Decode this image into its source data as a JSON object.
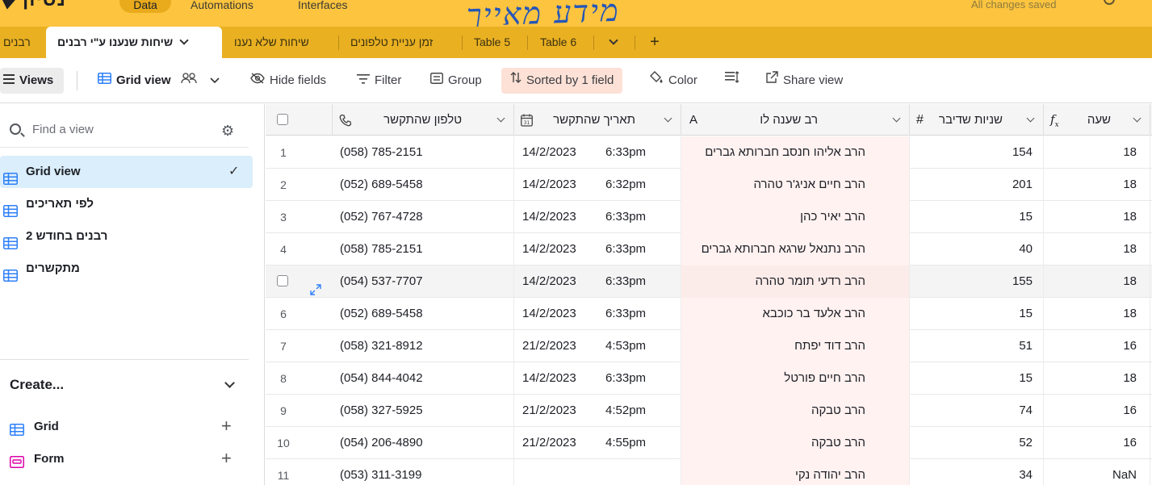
{
  "app": {
    "logo_text": "נסיון",
    "nav": {
      "data": "Data",
      "automations": "Automations",
      "interfaces": "Interfaces"
    },
    "save_status": "All changes saved",
    "handwritten_note": "מידע מאייך"
  },
  "tabs": {
    "items": [
      {
        "label": "רבנים"
      },
      {
        "label": "שיחות שנענו ע\"י רבנים",
        "active": true
      },
      {
        "label": "שיחות שלא נענו"
      },
      {
        "label": "זמן עניית טלפונים"
      },
      {
        "label": "Table 5"
      },
      {
        "label": "Table 6"
      }
    ],
    "more_icon": "chevron-down-icon",
    "add_label": "+"
  },
  "toolbar": {
    "views_label": "Views",
    "grid_view_label": "Grid view",
    "hide_fields_label": "Hide fields",
    "filter_label": "Filter",
    "group_label": "Group",
    "sorted_label": "Sorted by 1 field",
    "color_label": "Color",
    "share_view_label": "Share view",
    "sorted_bg": "#fde1d6"
  },
  "sidebar": {
    "find_placeholder": "Find a view",
    "views": [
      {
        "label": "Grid view",
        "selected": true
      },
      {
        "label": "לפי תאריכים"
      },
      {
        "label": "רבנים בחודש 2"
      },
      {
        "label": "מתקשרים"
      }
    ],
    "create_label": "Create...",
    "create_items": [
      {
        "label": "Grid"
      },
      {
        "label": "Form"
      }
    ]
  },
  "grid": {
    "columns": {
      "phone": "טלפון שהתקשר",
      "date": "תאריך שהתקשר",
      "rav": "רב שענה לו",
      "years": "שניות שדיבר",
      "hour": "שעה"
    },
    "rows": [
      {
        "n": "1",
        "phone": "(058) 785-2151",
        "date": "14/2/2023",
        "time": "6:33pm",
        "rav": "הרב אליהו חנסב חברותא גברים",
        "years": "154",
        "hour": "18"
      },
      {
        "n": "2",
        "phone": "(052) 689-5458",
        "date": "14/2/2023",
        "time": "6:32pm",
        "rav": "הרב חיים אניג'ר טהרה",
        "years": "201",
        "hour": "18"
      },
      {
        "n": "3",
        "phone": "(052) 767-4728",
        "date": "14/2/2023",
        "time": "6:33pm",
        "rav": "הרב יאיר כהן",
        "years": "15",
        "hour": "18"
      },
      {
        "n": "4",
        "phone": "(058) 785-2151",
        "date": "14/2/2023",
        "time": "6:33pm",
        "rav": "הרב נתנאל שרגא חברותא גברים",
        "years": "40",
        "hour": "18"
      },
      {
        "n": "",
        "phone": "(054) 537-7707",
        "date": "14/2/2023",
        "time": "6:33pm",
        "rav": "הרב רדעי תומר טהרה",
        "years": "155",
        "hour": "18",
        "hover": true
      },
      {
        "n": "6",
        "phone": "(052) 689-5458",
        "date": "14/2/2023",
        "time": "6:33pm",
        "rav": "הרב אלעד בר כוכבא",
        "years": "15",
        "hour": "18"
      },
      {
        "n": "7",
        "phone": "(058) 321-8912",
        "date": "21/2/2023",
        "time": "4:53pm",
        "rav": "הרב דוד יפתח",
        "years": "51",
        "hour": "16"
      },
      {
        "n": "8",
        "phone": "(054) 844-4042",
        "date": "14/2/2023",
        "time": "6:33pm",
        "rav": "הרב חיים פורטל",
        "years": "15",
        "hour": "18"
      },
      {
        "n": "9",
        "phone": "(058) 327-5925",
        "date": "21/2/2023",
        "time": "4:52pm",
        "rav": "הרב טבקה",
        "years": "74",
        "hour": "16"
      },
      {
        "n": "10",
        "phone": "(054) 206-4890",
        "date": "21/2/2023",
        "time": "4:55pm",
        "rav": "הרב טבקה",
        "years": "52",
        "hour": "16"
      },
      {
        "n": "11",
        "phone": "(053) 311-3199",
        "date": "",
        "time": "",
        "rav": "הרב יהודה נקי",
        "years": "34",
        "hour": "NaN"
      }
    ]
  }
}
